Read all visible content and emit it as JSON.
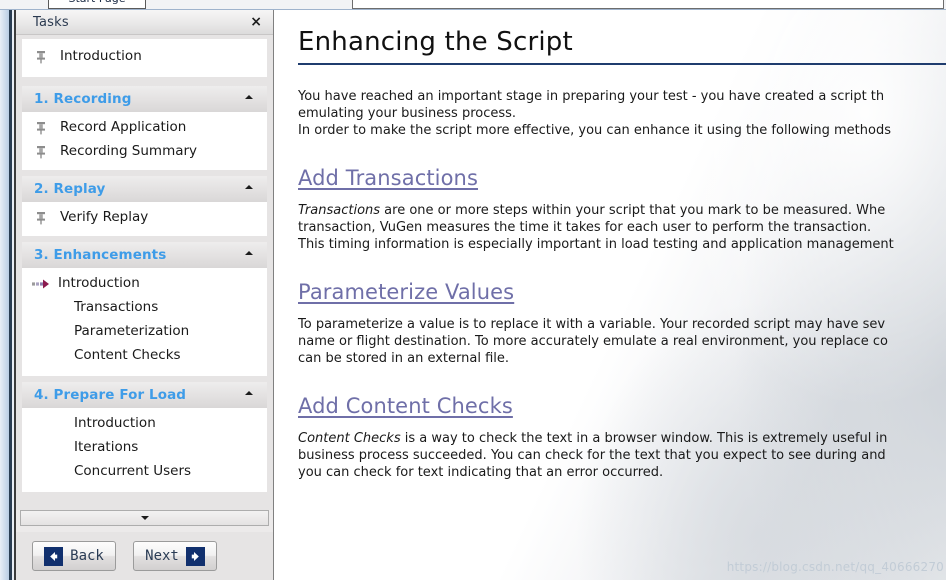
{
  "topbar": {
    "tab_label": "Start Page"
  },
  "sidebar": {
    "title": "Tasks",
    "close_icon": "×",
    "intro": {
      "label": "Introduction",
      "icon": "pin-icon"
    },
    "groups": [
      {
        "title": "1. Recording",
        "collapse_icon": "chevron-up-icon",
        "items": [
          {
            "label": "Record Application",
            "icon": "pin-icon"
          },
          {
            "label": "Recording Summary",
            "icon": "pin-icon"
          }
        ]
      },
      {
        "title": "2. Replay",
        "collapse_icon": "chevron-up-icon",
        "items": [
          {
            "label": "Verify Replay",
            "icon": "pin-icon"
          }
        ]
      },
      {
        "title": "3. Enhancements",
        "collapse_icon": "chevron-up-icon",
        "items": [
          {
            "label": "Introduction",
            "icon": "arrow-right-icon",
            "current": true
          },
          {
            "label": "Transactions",
            "icon": "none"
          },
          {
            "label": "Parameterization",
            "icon": "none"
          },
          {
            "label": "Content Checks",
            "icon": "none"
          }
        ]
      },
      {
        "title": "4. Prepare For Load",
        "collapse_icon": "chevron-up-icon",
        "items": [
          {
            "label": "Introduction",
            "icon": "none"
          },
          {
            "label": "Iterations",
            "icon": "none"
          },
          {
            "label": "Concurrent Users",
            "icon": "none"
          }
        ]
      }
    ],
    "scroll_down_icon": "chevron-down-icon",
    "nav": {
      "back_label": "Back",
      "next_label": "Next",
      "back_icon": "arrow-left-icon",
      "next_icon": "arrow-right-icon"
    }
  },
  "content": {
    "title": "Enhancing the Script",
    "intro_lines": [
      "You have reached an important stage in preparing your test - you have created a script th",
      "emulating your business process.",
      "In order to make the script more effective, you can enhance it using the following methods"
    ],
    "sections": [
      {
        "heading": "Add Transactions",
        "lead_italic": "Transactions",
        "lines": [
          " are one or more steps within your script that you mark to be measured. Whe",
          "transaction, VuGen measures the time it takes for each user to perform the transaction.",
          "This timing information is especially important in load testing and application management"
        ]
      },
      {
        "heading": "Parameterize Values",
        "lead_italic": "",
        "lines": [
          "To parameterize a value is to replace it with a variable. Your recorded script may have sev",
          "name or flight destination. To more accurately emulate a real environment, you replace co",
          "can be stored in an external file."
        ]
      },
      {
        "heading": "Add Content Checks",
        "lead_italic": "Content Checks",
        "lines": [
          " is a way to check the text in a browser window. This is extremely useful in",
          "business process succeeded. You can check for the text that you expect to see during and",
          "you can check for text indicating that an error occurred."
        ]
      }
    ],
    "watermark": "https://blog.csdn.net/qq_40666270"
  },
  "colors": {
    "group_title": "#3e9ce8",
    "section_heading": "#6f6fa8",
    "title_rule": "#1f3c6e",
    "nav_icon_bg": "#11306e"
  }
}
